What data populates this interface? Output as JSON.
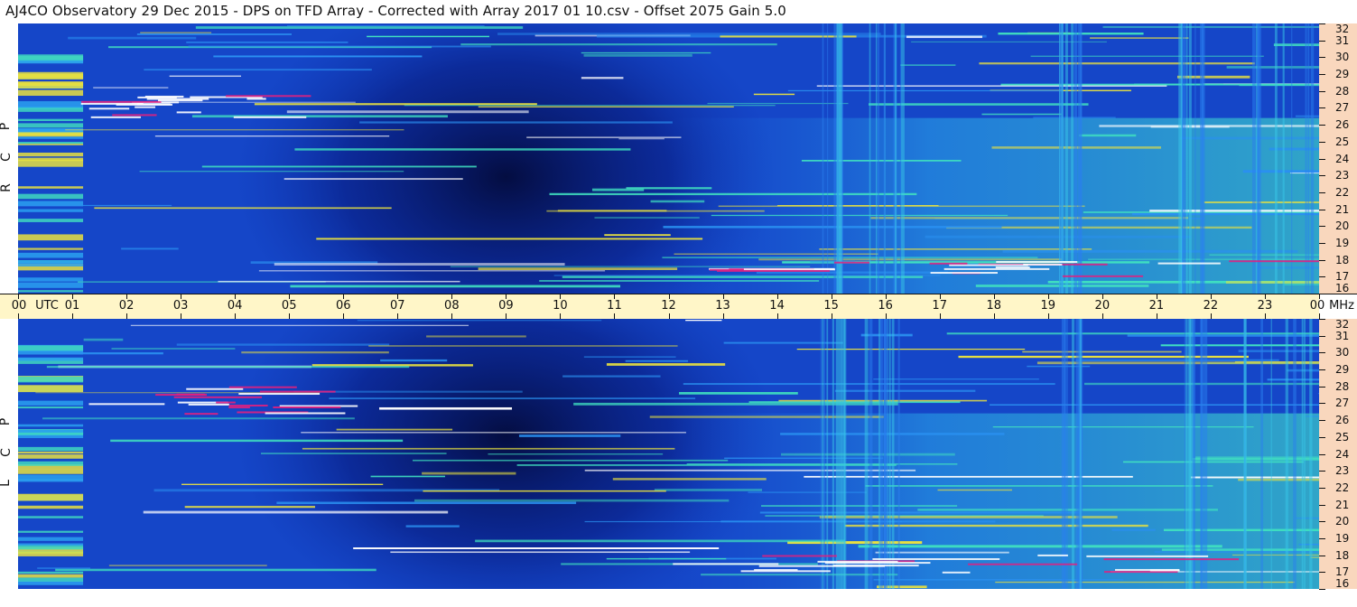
{
  "title": "AJ4CO Observatory  29 Dec 2015  -  DPS on TFD Array  -  Corrected with Array 2017 01 10.csv  -  Offset 2075  Gain 5.0",
  "chart_data": {
    "type": "heatmap",
    "x_axis": {
      "unit": "UTC",
      "ticks": [
        "00",
        "01",
        "02",
        "03",
        "04",
        "05",
        "06",
        "07",
        "08",
        "09",
        "10",
        "11",
        "12",
        "13",
        "14",
        "15",
        "16",
        "17",
        "18",
        "19",
        "20",
        "21",
        "22",
        "23",
        "00"
      ],
      "range": [
        0,
        24
      ]
    },
    "y_axis": {
      "unit": "MHz",
      "ticks": [
        32,
        31,
        30,
        29,
        28,
        27,
        26,
        25,
        24,
        23,
        22,
        21,
        20,
        19,
        18,
        17,
        16
      ],
      "range": [
        16,
        32
      ]
    },
    "panels": [
      {
        "polarization": "RCP",
        "letters": [
          "R",
          "C",
          "P"
        ]
      },
      {
        "polarization": "LCP",
        "letters": [
          "L",
          "C",
          "P"
        ]
      }
    ],
    "colors": {
      "low": "#061a6e",
      "mid": "#1f6cf0",
      "high": "#3fe0d0",
      "hot": "#ffffff",
      "accent": "#e02080"
    }
  },
  "labels": {
    "mhz": "MHz",
    "utc": "UTC"
  }
}
